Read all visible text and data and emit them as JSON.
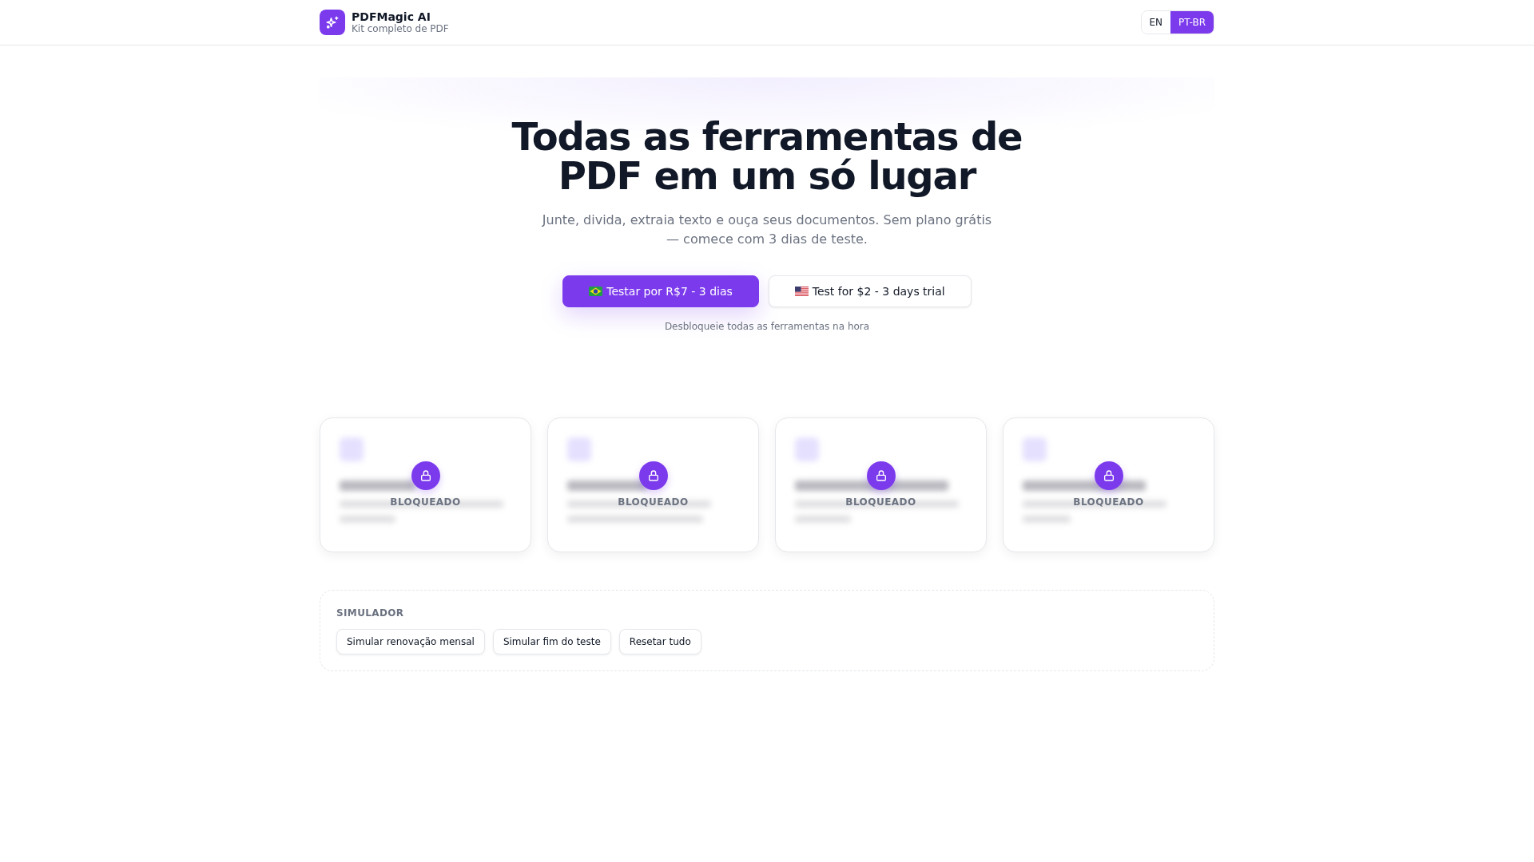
{
  "header": {
    "brand": {
      "name": "PDFMagic AI",
      "tagline": "Kit completo de PDF"
    },
    "languages": [
      {
        "label": "EN",
        "selected": false
      },
      {
        "label": "PT-BR",
        "selected": true
      }
    ]
  },
  "hero": {
    "title": "Todas as ferramentas de PDF em um só lugar",
    "subtitle": "Junte, divida, extraia texto e ouça seus documentos. Sem plano grátis — comece com 3 dias de teste.",
    "buttons": [
      {
        "label": "Testar por R$7 - 3 dias",
        "kind": "primary"
      },
      {
        "label": "Test for $2 - 3 days trial",
        "kind": "secondary"
      }
    ],
    "note": "Desbloqueie todas as ferramentas na hora"
  },
  "tools": [
    {
      "status": "BLOQUEADO",
      "locked": true
    },
    {
      "status": "BLOQUEADO",
      "locked": true
    },
    {
      "status": "BLOQUEADO",
      "locked": true
    },
    {
      "status": "BLOQUEADO",
      "locked": true
    }
  ],
  "simulator": {
    "title": "SIMULADOR",
    "buttons": [
      "Simular renovação mensal",
      "Simular fim do teste",
      "Resetar tudo"
    ]
  }
}
